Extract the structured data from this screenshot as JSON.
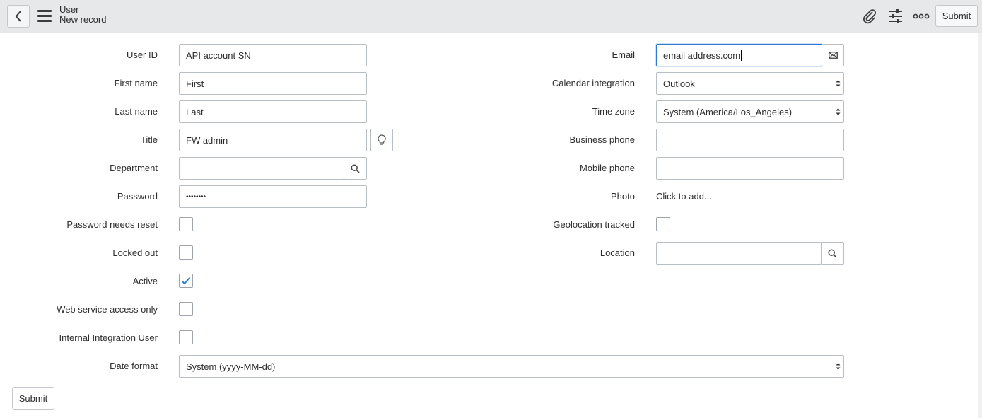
{
  "header": {
    "title": "User",
    "subtitle": "New record",
    "submit_label": "Submit"
  },
  "icons": {
    "back": "chevron-left-icon",
    "menu": "hamburger-icon",
    "attachment": "paperclip-icon",
    "personalize": "sliders-icon",
    "more": "more-options-icon",
    "email_action": "envelope-icon",
    "lookup": "search-icon",
    "suggest": "lightbulb-icon"
  },
  "form": {
    "user_id": {
      "label": "User ID",
      "value": "API account SN"
    },
    "first_name": {
      "label": "First name",
      "value": "First"
    },
    "last_name": {
      "label": "Last name",
      "value": "Last"
    },
    "title": {
      "label": "Title",
      "value": "FW admin"
    },
    "department": {
      "label": "Department",
      "value": ""
    },
    "password": {
      "label": "Password",
      "value": "••••••••"
    },
    "password_needs_reset": {
      "label": "Password needs reset",
      "checked": false
    },
    "locked_out": {
      "label": "Locked out",
      "checked": false
    },
    "active": {
      "label": "Active",
      "checked": true
    },
    "web_service_access_only": {
      "label": "Web service access only",
      "checked": false
    },
    "internal_integration_user": {
      "label": "Internal Integration User",
      "checked": false
    },
    "date_format": {
      "label": "Date format",
      "value": "System (yyyy-MM-dd)"
    },
    "email": {
      "label": "Email",
      "value": "email address.com"
    },
    "calendar_integration": {
      "label": "Calendar integration",
      "value": "Outlook"
    },
    "time_zone": {
      "label": "Time zone",
      "value": "System (America/Los_Angeles)"
    },
    "business_phone": {
      "label": "Business phone",
      "value": ""
    },
    "mobile_phone": {
      "label": "Mobile phone",
      "value": ""
    },
    "photo": {
      "label": "Photo",
      "value": "Click to add..."
    },
    "geolocation_tracked": {
      "label": "Geolocation tracked",
      "checked": false
    },
    "location": {
      "label": "Location",
      "value": ""
    }
  },
  "footer": {
    "submit_label": "Submit"
  },
  "colors": {
    "accent": "#2e7ad1",
    "header_bg": "#e6e8ea",
    "check": "#2e7ad1"
  }
}
